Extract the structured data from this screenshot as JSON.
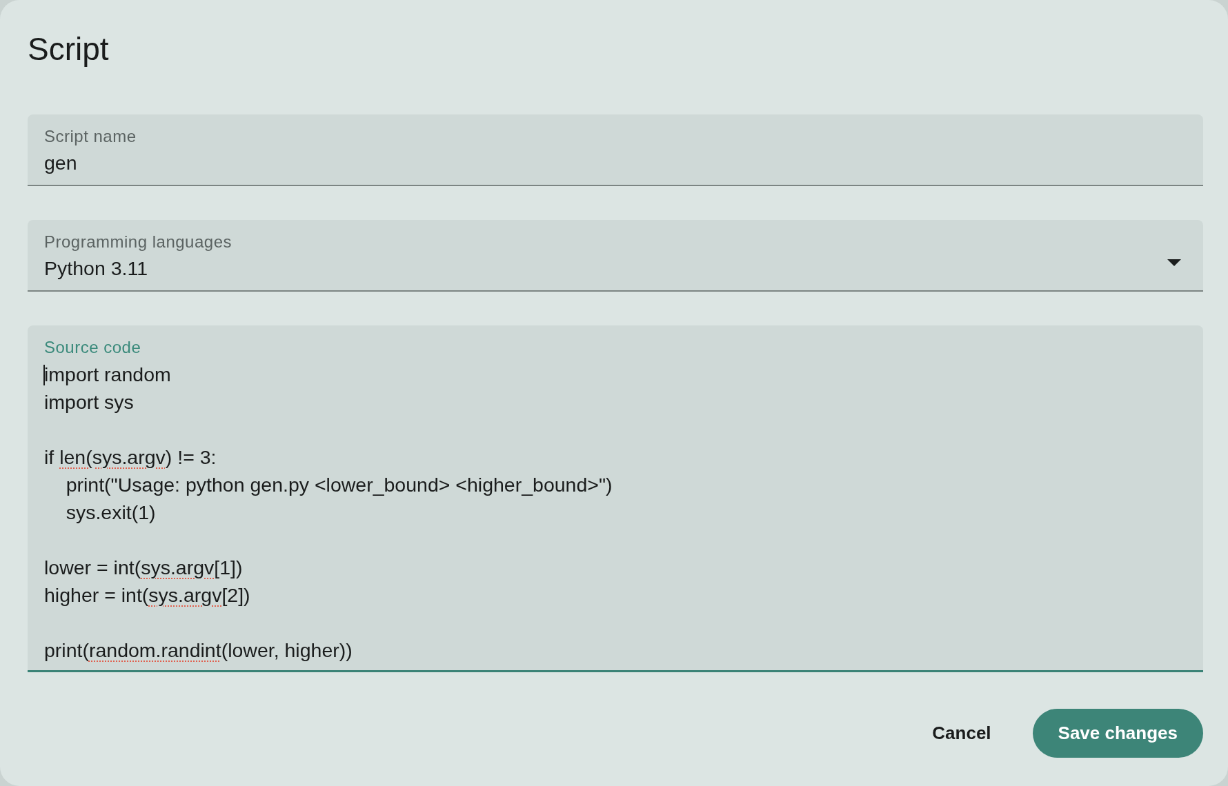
{
  "dialog": {
    "title": "Script"
  },
  "fields": [
    {
      "kind": "text",
      "label": "Script name",
      "value": "gen",
      "focused": false
    },
    {
      "kind": "select",
      "label": "Programming languages",
      "value": "Python 3.11",
      "focused": false
    },
    {
      "kind": "code",
      "label": "Source code",
      "focused": true,
      "blocks": [
        {
          "lines": [
            {
              "segments": [
                {
                  "text": "import random",
                  "misspelled": false
                }
              ]
            },
            {
              "segments": [
                {
                  "text": "import sys",
                  "misspelled": false
                }
              ]
            }
          ]
        },
        {
          "lines": [
            {
              "segments": [
                {
                  "text": "if ",
                  "misspelled": false
                },
                {
                  "text": "len(sys.argv",
                  "misspelled": true
                },
                {
                  "text": ") != 3:",
                  "misspelled": false
                }
              ]
            },
            {
              "segments": [
                {
                  "text": "    print(\"Usage: python gen.py <lower_bound> <higher_bound>\")",
                  "misspelled": false
                }
              ]
            },
            {
              "segments": [
                {
                  "text": "    sys.exit(1)",
                  "misspelled": false
                }
              ]
            }
          ]
        },
        {
          "lines": [
            {
              "segments": [
                {
                  "text": "lower = int(",
                  "misspelled": false
                },
                {
                  "text": "sys.argv",
                  "misspelled": true
                },
                {
                  "text": "[1])",
                  "misspelled": false
                }
              ]
            },
            {
              "segments": [
                {
                  "text": "higher = int(",
                  "misspelled": false
                },
                {
                  "text": "sys.argv",
                  "misspelled": true
                },
                {
                  "text": "[2])",
                  "misspelled": false
                }
              ]
            }
          ]
        },
        {
          "lines": [
            {
              "segments": [
                {
                  "text": "print(",
                  "misspelled": false
                },
                {
                  "text": "random.randint",
                  "misspelled": true
                },
                {
                  "text": "(lower, higher))",
                  "misspelled": false
                }
              ]
            }
          ]
        }
      ]
    }
  ],
  "buttons": [
    {
      "kind": "text",
      "label": "Cancel"
    },
    {
      "kind": "filled",
      "label": "Save changes"
    }
  ]
}
